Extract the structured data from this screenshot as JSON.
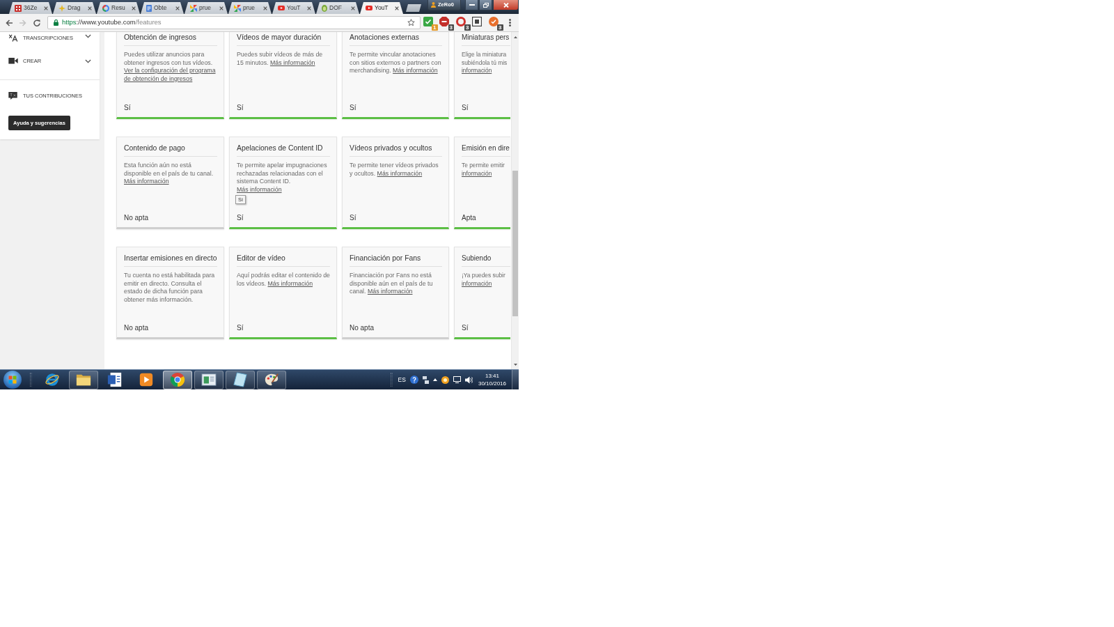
{
  "browser": {
    "tabs": [
      {
        "title": "36Ze",
        "selected": false
      },
      {
        "title": "Drag",
        "selected": false
      },
      {
        "title": "Resu",
        "selected": false
      },
      {
        "title": "Obte",
        "selected": false
      },
      {
        "title": "prue",
        "selected": false
      },
      {
        "title": "prue",
        "selected": false
      },
      {
        "title": "YouT",
        "selected": false
      },
      {
        "title": "DOF",
        "selected": false
      },
      {
        "title": "YouT",
        "selected": true
      }
    ],
    "profile": "ZeRo0",
    "nav_buttons": [
      {
        "kind": "back",
        "disabled": false
      },
      {
        "kind": "forward",
        "disabled": true
      },
      {
        "kind": "reload",
        "disabled": false
      }
    ],
    "url": "https://www.youtube.com/features",
    "extensions": [
      {
        "kind": "tick",
        "badge": "1",
        "color": "#e39a2d"
      },
      {
        "kind": "octagon",
        "badge": "3",
        "color": "#4a4a4a"
      },
      {
        "kind": "ring",
        "badge": "3",
        "color": "#4a4a4a"
      },
      {
        "kind": "square"
      },
      {
        "kind": "check",
        "badge": "3",
        "color": "#4a4a4a"
      }
    ]
  },
  "sidebar": {
    "sections": [
      [
        {
          "label": "TRANSCRIPCIONES",
          "expandable": true
        },
        {
          "label": "CREAR",
          "expandable": true
        }
      ],
      [
        {
          "label": "TUS CONTRIBUCIONES",
          "expandable": false
        }
      ]
    ],
    "help_button": "Ayuda y sugerencias"
  },
  "feature_cards": [
    {
      "title": "Obtención de ingresos",
      "description": "Puedes utilizar anuncios para obtener ingresos con tus vídeos.",
      "link": "Ver la configuración del programa de obtención de ingresos",
      "status": "Sí",
      "available": true
    },
    {
      "title": "Vídeos de mayor duración",
      "description": "Puedes subir vídeos de más de 15 minutos.",
      "link": "Más información",
      "status": "Sí",
      "available": true
    },
    {
      "title": "Anotaciones externas",
      "description": "Te permite vincular anotaciones con sitios externos o partners con merchandising.",
      "link": "Más información",
      "status": "Sí",
      "available": true
    },
    {
      "title": "Miniaturas pers",
      "description": "Elige la miniatura subiéndola tú mis",
      "link": "información",
      "status": "Sí",
      "available": true
    },
    {
      "title": "Contenido de pago",
      "description": "Esta función aún no está disponible en el país de tu canal.",
      "link": "Más información",
      "status": "No apta",
      "available": false
    },
    {
      "title": "Apelaciones de Content ID",
      "description": "Te permite apelar impugnaciones rechazadas relacionadas con el sistema Content ID.",
      "link": "Más información",
      "status": "Sí",
      "available": true,
      "tooltip": "Sí"
    },
    {
      "title": "Vídeos privados y ocultos",
      "description": "Te permite tener vídeos privados y ocultos.",
      "link": "Más información",
      "status": "Sí",
      "available": true
    },
    {
      "title": "Emisión en dire",
      "description": "Te permite emitir",
      "link": "información",
      "status": "Apta",
      "available": true
    },
    {
      "title": "Insertar emisiones en directo",
      "description": "Tu cuenta no está habilitada para emitir en directo. Consulta el estado de dicha función para obtener más información.",
      "status": "No apta",
      "available": false
    },
    {
      "title": "Editor de vídeo",
      "description": "Aquí podrás editar el contenido de los vídeos.",
      "link": "Más información",
      "status": "Sí",
      "available": true
    },
    {
      "title": "Financiación por Fans",
      "description": "Financiación por Fans no está disponible aún en el país de tu canal.",
      "link": "Más información",
      "status": "No apta",
      "available": false
    },
    {
      "title": "Subiendo",
      "description": "¡Ya puedes subir",
      "link": "información",
      "status": "Sí",
      "available": true
    }
  ],
  "taskbar": {
    "apps": [
      {
        "running": false,
        "selected": false
      },
      {
        "running": true,
        "selected": false
      },
      {
        "running": false,
        "selected": false
      },
      {
        "running": false,
        "selected": false
      },
      {
        "running": true,
        "selected": true
      },
      {
        "running": true,
        "selected": false
      },
      {
        "running": true,
        "selected": false
      },
      {
        "running": true,
        "selected": false
      }
    ],
    "language": "ES",
    "time": "13:41",
    "date": "30/10/2016"
  }
}
